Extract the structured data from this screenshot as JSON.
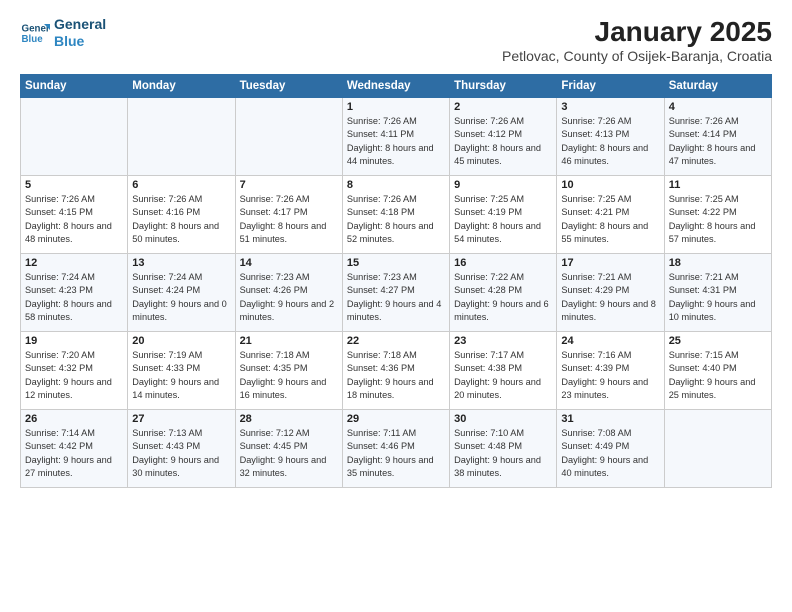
{
  "logo": {
    "line1": "General",
    "line2": "Blue"
  },
  "title": "January 2025",
  "subtitle": "Petlovac, County of Osijek-Baranja, Croatia",
  "headers": [
    "Sunday",
    "Monday",
    "Tuesday",
    "Wednesday",
    "Thursday",
    "Friday",
    "Saturday"
  ],
  "weeks": [
    [
      {
        "day": "",
        "text": ""
      },
      {
        "day": "",
        "text": ""
      },
      {
        "day": "",
        "text": ""
      },
      {
        "day": "1",
        "text": "Sunrise: 7:26 AM\nSunset: 4:11 PM\nDaylight: 8 hours and 44 minutes."
      },
      {
        "day": "2",
        "text": "Sunrise: 7:26 AM\nSunset: 4:12 PM\nDaylight: 8 hours and 45 minutes."
      },
      {
        "day": "3",
        "text": "Sunrise: 7:26 AM\nSunset: 4:13 PM\nDaylight: 8 hours and 46 minutes."
      },
      {
        "day": "4",
        "text": "Sunrise: 7:26 AM\nSunset: 4:14 PM\nDaylight: 8 hours and 47 minutes."
      }
    ],
    [
      {
        "day": "5",
        "text": "Sunrise: 7:26 AM\nSunset: 4:15 PM\nDaylight: 8 hours and 48 minutes."
      },
      {
        "day": "6",
        "text": "Sunrise: 7:26 AM\nSunset: 4:16 PM\nDaylight: 8 hours and 50 minutes."
      },
      {
        "day": "7",
        "text": "Sunrise: 7:26 AM\nSunset: 4:17 PM\nDaylight: 8 hours and 51 minutes."
      },
      {
        "day": "8",
        "text": "Sunrise: 7:26 AM\nSunset: 4:18 PM\nDaylight: 8 hours and 52 minutes."
      },
      {
        "day": "9",
        "text": "Sunrise: 7:25 AM\nSunset: 4:19 PM\nDaylight: 8 hours and 54 minutes."
      },
      {
        "day": "10",
        "text": "Sunrise: 7:25 AM\nSunset: 4:21 PM\nDaylight: 8 hours and 55 minutes."
      },
      {
        "day": "11",
        "text": "Sunrise: 7:25 AM\nSunset: 4:22 PM\nDaylight: 8 hours and 57 minutes."
      }
    ],
    [
      {
        "day": "12",
        "text": "Sunrise: 7:24 AM\nSunset: 4:23 PM\nDaylight: 8 hours and 58 minutes."
      },
      {
        "day": "13",
        "text": "Sunrise: 7:24 AM\nSunset: 4:24 PM\nDaylight: 9 hours and 0 minutes."
      },
      {
        "day": "14",
        "text": "Sunrise: 7:23 AM\nSunset: 4:26 PM\nDaylight: 9 hours and 2 minutes."
      },
      {
        "day": "15",
        "text": "Sunrise: 7:23 AM\nSunset: 4:27 PM\nDaylight: 9 hours and 4 minutes."
      },
      {
        "day": "16",
        "text": "Sunrise: 7:22 AM\nSunset: 4:28 PM\nDaylight: 9 hours and 6 minutes."
      },
      {
        "day": "17",
        "text": "Sunrise: 7:21 AM\nSunset: 4:29 PM\nDaylight: 9 hours and 8 minutes."
      },
      {
        "day": "18",
        "text": "Sunrise: 7:21 AM\nSunset: 4:31 PM\nDaylight: 9 hours and 10 minutes."
      }
    ],
    [
      {
        "day": "19",
        "text": "Sunrise: 7:20 AM\nSunset: 4:32 PM\nDaylight: 9 hours and 12 minutes."
      },
      {
        "day": "20",
        "text": "Sunrise: 7:19 AM\nSunset: 4:33 PM\nDaylight: 9 hours and 14 minutes."
      },
      {
        "day": "21",
        "text": "Sunrise: 7:18 AM\nSunset: 4:35 PM\nDaylight: 9 hours and 16 minutes."
      },
      {
        "day": "22",
        "text": "Sunrise: 7:18 AM\nSunset: 4:36 PM\nDaylight: 9 hours and 18 minutes."
      },
      {
        "day": "23",
        "text": "Sunrise: 7:17 AM\nSunset: 4:38 PM\nDaylight: 9 hours and 20 minutes."
      },
      {
        "day": "24",
        "text": "Sunrise: 7:16 AM\nSunset: 4:39 PM\nDaylight: 9 hours and 23 minutes."
      },
      {
        "day": "25",
        "text": "Sunrise: 7:15 AM\nSunset: 4:40 PM\nDaylight: 9 hours and 25 minutes."
      }
    ],
    [
      {
        "day": "26",
        "text": "Sunrise: 7:14 AM\nSunset: 4:42 PM\nDaylight: 9 hours and 27 minutes."
      },
      {
        "day": "27",
        "text": "Sunrise: 7:13 AM\nSunset: 4:43 PM\nDaylight: 9 hours and 30 minutes."
      },
      {
        "day": "28",
        "text": "Sunrise: 7:12 AM\nSunset: 4:45 PM\nDaylight: 9 hours and 32 minutes."
      },
      {
        "day": "29",
        "text": "Sunrise: 7:11 AM\nSunset: 4:46 PM\nDaylight: 9 hours and 35 minutes."
      },
      {
        "day": "30",
        "text": "Sunrise: 7:10 AM\nSunset: 4:48 PM\nDaylight: 9 hours and 38 minutes."
      },
      {
        "day": "31",
        "text": "Sunrise: 7:08 AM\nSunset: 4:49 PM\nDaylight: 9 hours and 40 minutes."
      },
      {
        "day": "",
        "text": ""
      }
    ]
  ]
}
